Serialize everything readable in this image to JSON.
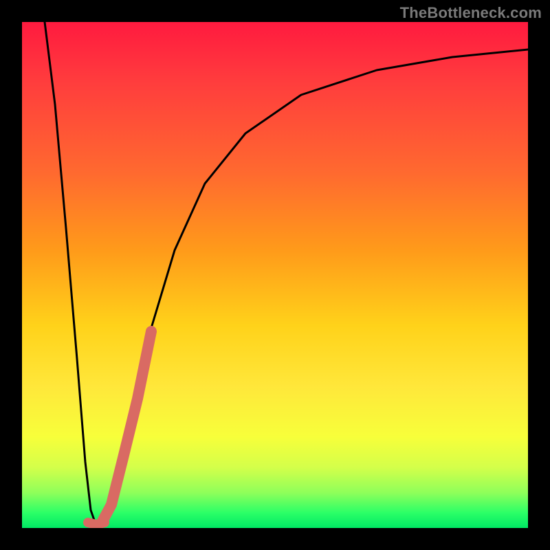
{
  "watermark": {
    "text": "TheBottleneck.com"
  },
  "colors": {
    "bg_black": "#000000",
    "curve_stroke": "#000000",
    "marker_fill": "#d96a63",
    "gradient_top": "#ff1a3f",
    "gradient_bottom": "#00e864"
  },
  "chart_data": {
    "type": "line",
    "title": "",
    "xlabel": "",
    "ylabel": "",
    "xlim": [
      0,
      100
    ],
    "ylim": [
      0,
      100
    ],
    "grid": false,
    "legend": false,
    "note": "Axes have no visible tick labels; x and y are on an arbitrary 0–100 scale read from pixel position.",
    "series": [
      {
        "name": "curve",
        "stroke": "#000000",
        "points": [
          {
            "x": 4.5,
            "y": 100.0
          },
          {
            "x": 6.0,
            "y": 80.0
          },
          {
            "x": 8.0,
            "y": 55.0
          },
          {
            "x": 10.0,
            "y": 30.0
          },
          {
            "x": 12.0,
            "y": 10.0
          },
          {
            "x": 13.5,
            "y": 2.0
          },
          {
            "x": 14.5,
            "y": 0.5
          },
          {
            "x": 16.0,
            "y": 1.0
          },
          {
            "x": 18.0,
            "y": 6.0
          },
          {
            "x": 21.0,
            "y": 20.0
          },
          {
            "x": 25.0,
            "y": 38.0
          },
          {
            "x": 30.0,
            "y": 55.0
          },
          {
            "x": 36.0,
            "y": 68.0
          },
          {
            "x": 44.0,
            "y": 78.0
          },
          {
            "x": 55.0,
            "y": 85.5
          },
          {
            "x": 70.0,
            "y": 90.5
          },
          {
            "x": 85.0,
            "y": 93.0
          },
          {
            "x": 100.0,
            "y": 94.5
          }
        ]
      },
      {
        "name": "highlight-segment",
        "stroke": "#d96a63",
        "stroke_width_px": 14,
        "points": [
          {
            "x": 15.5,
            "y": 1.0
          },
          {
            "x": 17.5,
            "y": 4.5
          },
          {
            "x": 20.0,
            "y": 14.0
          },
          {
            "x": 22.5,
            "y": 25.0
          },
          {
            "x": 25.5,
            "y": 38.0
          }
        ]
      },
      {
        "name": "min-marker",
        "type": "scatter",
        "fill": "#d96a63",
        "points": [
          {
            "x": 13.5,
            "y": 1.0
          },
          {
            "x": 14.5,
            "y": 0.5
          },
          {
            "x": 15.5,
            "y": 1.0
          }
        ]
      }
    ]
  }
}
